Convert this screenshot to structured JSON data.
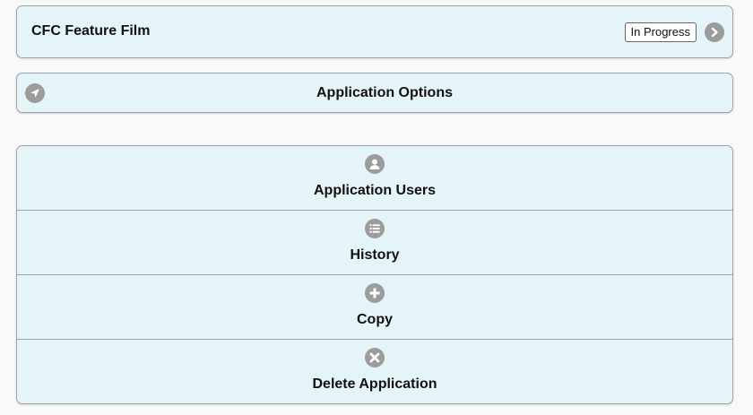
{
  "header": {
    "title": "CFC Feature Film",
    "status": "In Progress"
  },
  "options": {
    "title": "Application Options"
  },
  "actions": [
    {
      "label": "Application Users",
      "icon": "user-icon"
    },
    {
      "label": "History",
      "icon": "list-icon"
    },
    {
      "label": "Copy",
      "icon": "plus-icon"
    },
    {
      "label": "Delete Application",
      "icon": "close-icon"
    }
  ],
  "colors": {
    "panel_bg": "#e5f4f8",
    "panel_border": "#9aa5a8",
    "icon_bg": "#9c9c9c",
    "page_bg": "#f9f9f9"
  }
}
